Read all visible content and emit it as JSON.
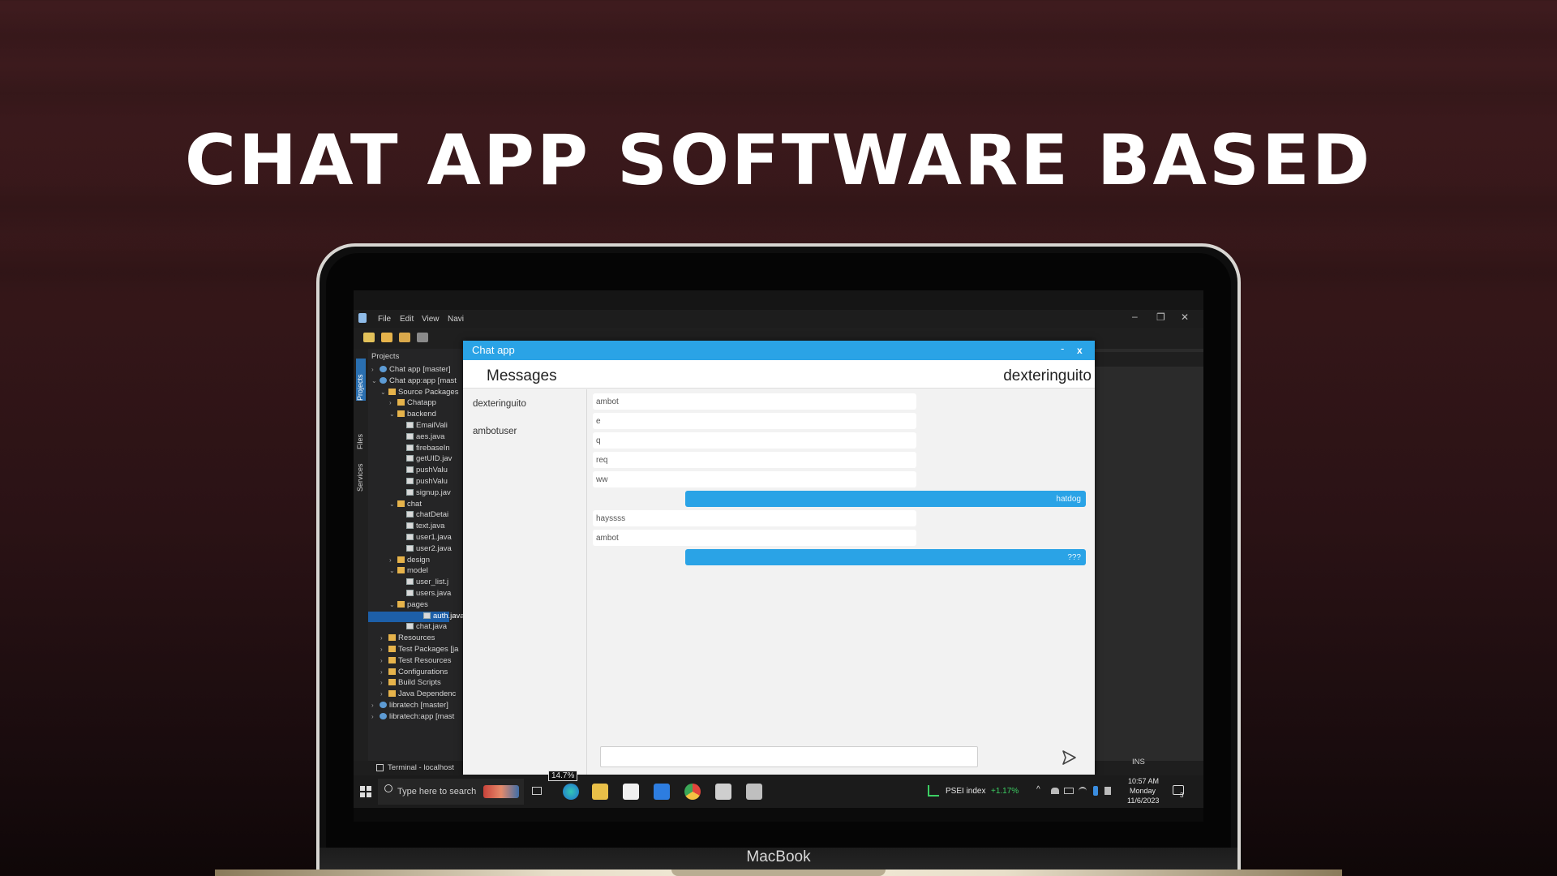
{
  "headline": "CHAT APP SOFTWARE BASED",
  "laptop_brand": "MacBook",
  "ide": {
    "menu": [
      "File",
      "Edit",
      "View",
      "Navi"
    ],
    "projects_title": "Projects",
    "side_tabs": [
      "Projects",
      "Files",
      "Services"
    ],
    "tree": [
      {
        "label": "Chat app [master]",
        "indent": 0,
        "arrow": "›",
        "icon": "proj"
      },
      {
        "label": "Chat app:app [mast",
        "indent": 0,
        "arrow": "⌄",
        "icon": "proj"
      },
      {
        "label": "Source Packages",
        "indent": 1,
        "arrow": "⌄",
        "icon": "folder"
      },
      {
        "label": "Chatapp",
        "indent": 2,
        "arrow": "›",
        "icon": "folder"
      },
      {
        "label": "backend",
        "indent": 2,
        "arrow": "⌄",
        "icon": "folder"
      },
      {
        "label": "EmailVali",
        "indent": 3,
        "arrow": "",
        "icon": "file"
      },
      {
        "label": "aes.java",
        "indent": 3,
        "arrow": "",
        "icon": "file"
      },
      {
        "label": "firebaseIn",
        "indent": 3,
        "arrow": "",
        "icon": "file"
      },
      {
        "label": "getUID.jav",
        "indent": 3,
        "arrow": "",
        "icon": "file"
      },
      {
        "label": "pushValu",
        "indent": 3,
        "arrow": "",
        "icon": "file"
      },
      {
        "label": "pushValu",
        "indent": 3,
        "arrow": "",
        "icon": "file"
      },
      {
        "label": "signup.jav",
        "indent": 3,
        "arrow": "",
        "icon": "file"
      },
      {
        "label": "chat",
        "indent": 2,
        "arrow": "⌄",
        "icon": "folder"
      },
      {
        "label": "chatDetai",
        "indent": 3,
        "arrow": "",
        "icon": "file"
      },
      {
        "label": "text.java",
        "indent": 3,
        "arrow": "",
        "icon": "file"
      },
      {
        "label": "user1.java",
        "indent": 3,
        "arrow": "",
        "icon": "file"
      },
      {
        "label": "user2.java",
        "indent": 3,
        "arrow": "",
        "icon": "file"
      },
      {
        "label": "design",
        "indent": 2,
        "arrow": "›",
        "icon": "folder"
      },
      {
        "label": "model",
        "indent": 2,
        "arrow": "⌄",
        "icon": "folder"
      },
      {
        "label": "user_list.j",
        "indent": 3,
        "arrow": "",
        "icon": "file"
      },
      {
        "label": "users.java",
        "indent": 3,
        "arrow": "",
        "icon": "file"
      },
      {
        "label": "pages",
        "indent": 2,
        "arrow": "⌄",
        "icon": "folder"
      },
      {
        "label": "auth.java",
        "indent": 3,
        "arrow": "",
        "icon": "file",
        "selected": true
      },
      {
        "label": "chat.java",
        "indent": 3,
        "arrow": "",
        "icon": "file"
      },
      {
        "label": "Resources",
        "indent": 1,
        "arrow": "›",
        "icon": "folder"
      },
      {
        "label": "Test Packages [ja",
        "indent": 1,
        "arrow": "›",
        "icon": "folder"
      },
      {
        "label": "Test Resources",
        "indent": 1,
        "arrow": "›",
        "icon": "folder"
      },
      {
        "label": "Configurations",
        "indent": 1,
        "arrow": "›",
        "icon": "folder"
      },
      {
        "label": "Build Scripts",
        "indent": 1,
        "arrow": "›",
        "icon": "folder"
      },
      {
        "label": "Java Dependenc",
        "indent": 1,
        "arrow": "›",
        "icon": "folder"
      },
      {
        "label": "libratech [master]",
        "indent": 0,
        "arrow": "›",
        "icon": "proj"
      },
      {
        "label": "libratech:app [mast",
        "indent": 0,
        "arrow": "›",
        "icon": "proj"
      }
    ],
    "terminal_label": "Terminal - localhost",
    "ins_label": "INS"
  },
  "chat": {
    "window_title": "Chat app",
    "minimize_glyph": "-",
    "close_glyph": "x",
    "messages_heading": "Messages",
    "current_user": "dexteringuito",
    "users": [
      "dexteringuito",
      "ambotuser"
    ],
    "messages": [
      {
        "text": "ambot",
        "type": "recv"
      },
      {
        "text": "e",
        "type": "recv"
      },
      {
        "text": "q",
        "type": "recv"
      },
      {
        "text": "req",
        "type": "recv"
      },
      {
        "text": "ww",
        "type": "recv"
      },
      {
        "text": "hatdog",
        "type": "sent"
      },
      {
        "text": "hayssss",
        "type": "recv"
      },
      {
        "text": "ambot",
        "type": "recv"
      },
      {
        "text": "???",
        "type": "sent"
      }
    ],
    "composer_value": ""
  },
  "taskbar": {
    "search_placeholder": "Type here to search",
    "cpu_badge": "14.7%",
    "stock_label": "PSEI index",
    "stock_change": "+1.17%",
    "time": "10:57 AM",
    "day": "Monday",
    "date": "11/6/2023",
    "notification_count": "3"
  },
  "colors": {
    "chat_accent": "#2aa3e6",
    "stock_up": "#3ccf63",
    "selection": "#1d5fa8"
  }
}
